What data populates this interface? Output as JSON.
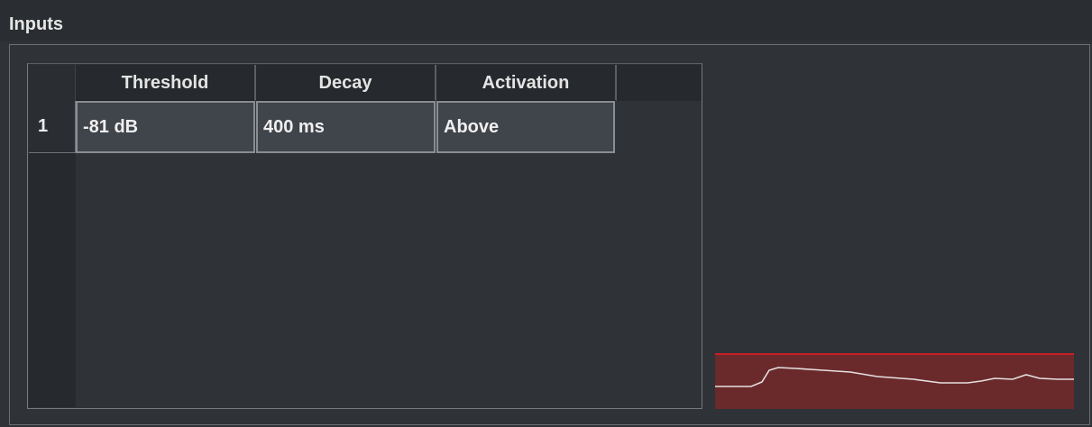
{
  "panel": {
    "title": "Inputs"
  },
  "table": {
    "columns": [
      "Threshold",
      "Decay",
      "Activation"
    ],
    "rows": [
      {
        "index": "1",
        "threshold": "-81 dB",
        "decay": "400 ms",
        "activation": "Above"
      }
    ]
  },
  "meter": {
    "fill_color": "#6a2a2c",
    "threshold_line_color": "#c81f25",
    "trace_color": "#e6e0e0"
  }
}
